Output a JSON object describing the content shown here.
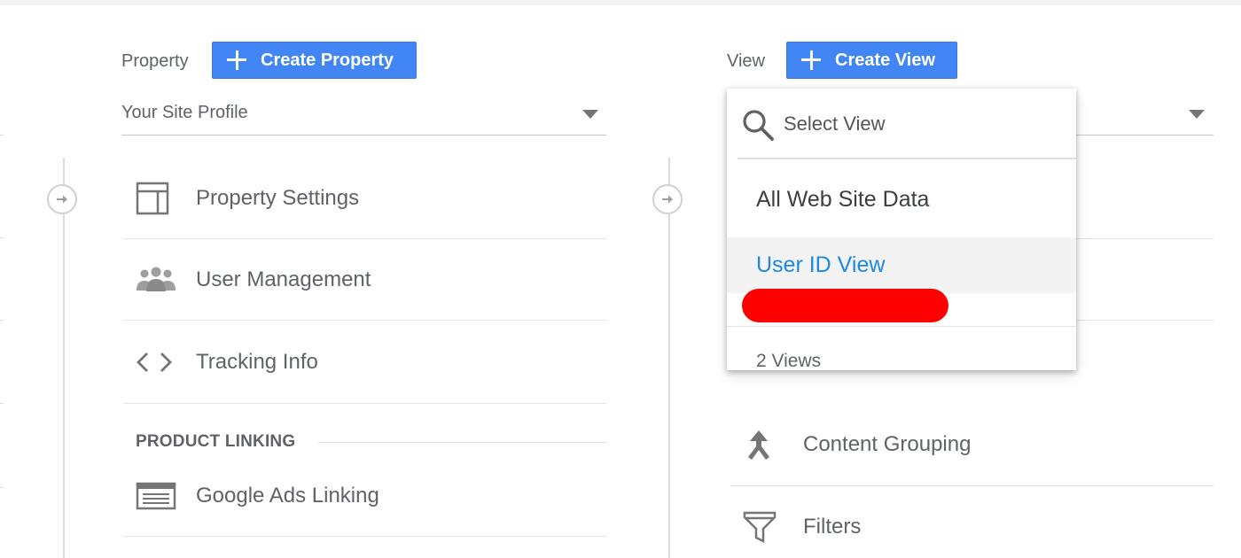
{
  "property": {
    "label": "Property",
    "create_button": "Create Property",
    "selected": "Your Site Profile",
    "items": [
      {
        "label": "Property Settings",
        "icon": "property-settings-icon"
      },
      {
        "label": "User Management",
        "icon": "users-icon"
      },
      {
        "label": "Tracking Info",
        "icon": "code-brackets-icon"
      }
    ],
    "section_heading": "PRODUCT LINKING",
    "linking_items": [
      {
        "label": "Google Ads Linking",
        "icon": "google-ads-icon"
      }
    ]
  },
  "view": {
    "label": "View",
    "create_button": "Create View",
    "items": [
      {
        "label": "Content Grouping",
        "icon": "content-grouping-icon"
      },
      {
        "label": "Filters",
        "icon": "filter-funnel-icon"
      }
    ],
    "dropdown": {
      "search_placeholder": "Select View",
      "options": [
        "All Web Site Data",
        "User ID View"
      ],
      "selected": "User ID View",
      "footer": "2 Views"
    }
  },
  "colors": {
    "button_blue": "#4285f4",
    "selected_text": "#1e88e5",
    "redaction": "#ff0000"
  }
}
